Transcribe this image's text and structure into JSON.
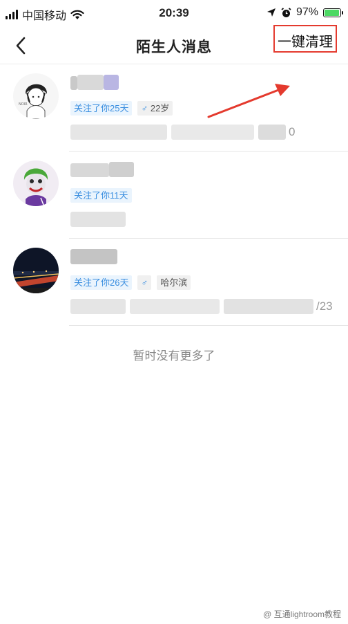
{
  "status_bar": {
    "carrier": "中国移动",
    "time": "20:39",
    "battery": "97%",
    "battery_level": 0.97
  },
  "nav": {
    "title": "陌生人消息",
    "clear_label": "一键清理"
  },
  "messages": [
    {
      "follow_tag": "关注了你25天",
      "gender_symbol": "♂",
      "age": "22岁",
      "preview_suffix": "0"
    },
    {
      "follow_tag": "关注了你11天"
    },
    {
      "follow_tag": "关注了你26天",
      "gender_symbol": "♂",
      "city": "哈尔滨",
      "preview_suffix": "/23"
    }
  ],
  "footer_note": "暂时没有更多了",
  "watermark": "@ 互通lightroom教程",
  "colors": {
    "accent_blue": "#3a8ee0",
    "highlight_red": "#e43a2e"
  }
}
